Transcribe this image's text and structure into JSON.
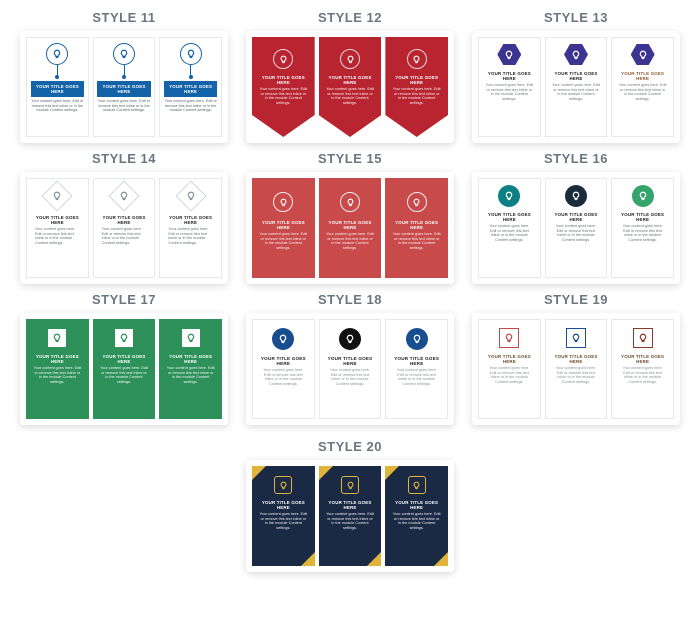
{
  "common": {
    "card_title": "Your Title Goes Here",
    "card_desc": "Your content goes here. Edit or remove this text inline or in the module Content settings."
  },
  "styles": [
    {
      "id": 11,
      "label": "STYLE 11"
    },
    {
      "id": 12,
      "label": "STYLE 12"
    },
    {
      "id": 13,
      "label": "STYLE 13"
    },
    {
      "id": 14,
      "label": "STYLE 14"
    },
    {
      "id": 15,
      "label": "STYLE 15"
    },
    {
      "id": 16,
      "label": "STYLE 16"
    },
    {
      "id": 17,
      "label": "STYLE 17"
    },
    {
      "id": 18,
      "label": "STYLE 18"
    },
    {
      "id": 19,
      "label": "STYLE 19"
    },
    {
      "id": 20,
      "label": "STYLE 20"
    }
  ],
  "icon_semantic": "lightbulb-icon",
  "colors": {
    "blue": "#1363a8",
    "red_dark": "#b82531",
    "red": "#c94a4a",
    "purple": "#3b3591",
    "green": "#2e915a",
    "teal": "#0d8084",
    "navy": "#1a2a44",
    "gold": "#e0b33a"
  }
}
